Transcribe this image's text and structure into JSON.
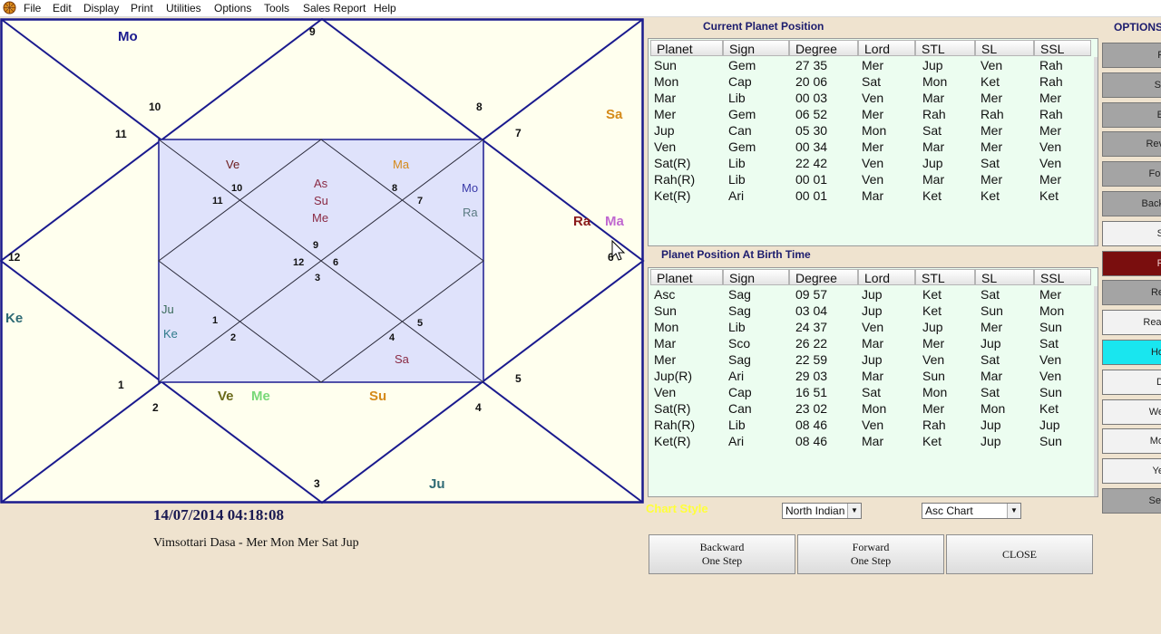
{
  "menu": [
    "File",
    "Edit",
    "Display",
    "Print",
    "Utilities",
    "Options",
    "Tools",
    "Sales Report",
    "Help"
  ],
  "chart": {
    "houses": [
      "1",
      "2",
      "3",
      "4",
      "5",
      "6",
      "7",
      "8",
      "9",
      "10",
      "11",
      "12"
    ],
    "outer_planets": {
      "mo": "Mo",
      "sa": "Sa",
      "ra": "Ra",
      "ma": "Ma",
      "ke": "Ke",
      "ve": "Ve",
      "me": "Me",
      "su": "Su",
      "ju": "Ju"
    },
    "inner_houses": [
      "1",
      "2",
      "3",
      "4",
      "5",
      "6",
      "7",
      "8",
      "9",
      "10",
      "11",
      "12"
    ],
    "inner_planets": {
      "ve": "Ve",
      "as": "As",
      "su": "Su",
      "me": "Me",
      "ma": "Ma",
      "mo": "Mo",
      "ra": "Ra",
      "ju": "Ju",
      "ke": "Ke",
      "sa": "Sa"
    },
    "colors": {
      "line": "#1a1a8e",
      "outer_bg": "#ffffee",
      "inner_bg": "#dfe2fb",
      "inner_line": "#2a2a3a",
      "orange": "#d58a1a",
      "dark_red": "#8a1a1a",
      "violet": "#c068d0",
      "teal": "#2e6a74",
      "olive": "#6a6a1a",
      "light_green": "#78d878",
      "maroon": "#8a2a44"
    }
  },
  "date_time": "14/07/2014 04:18:08",
  "dasa": "Vimsottari Dasa -  Mer Mon Mer Sat Jup",
  "current": {
    "title": "Current Planet Position",
    "headers": [
      "Planet",
      "Sign",
      "Degree",
      "Lord",
      "STL",
      "SL",
      "SSL"
    ],
    "rows": [
      [
        "Sun",
        "Gem",
        "27 35",
        "Mer",
        "Jup",
        "Ven",
        "Rah"
      ],
      [
        "Mon",
        "Cap",
        "20 06",
        "Sat",
        "Mon",
        "Ket",
        "Rah"
      ],
      [
        "Mar",
        "Lib",
        "00 03",
        "Ven",
        "Mar",
        "Mer",
        "Mer"
      ],
      [
        "Mer",
        "Gem",
        "06 52",
        "Mer",
        "Rah",
        "Rah",
        "Rah"
      ],
      [
        "Jup",
        "Can",
        "05 30",
        "Mon",
        "Sat",
        "Mer",
        "Mer"
      ],
      [
        "Ven",
        "Gem",
        "00 34",
        "Mer",
        "Mar",
        "Mer",
        "Ven"
      ],
      [
        "Sat(R)",
        "Lib",
        "22 42",
        "Ven",
        "Jup",
        "Sat",
        "Ven"
      ],
      [
        "Rah(R)",
        "Lib",
        "00 01",
        "Ven",
        "Mar",
        "Mer",
        "Mer"
      ],
      [
        "Ket(R)",
        "Ari",
        "00 01",
        "Mar",
        "Ket",
        "Ket",
        "Ket"
      ]
    ]
  },
  "birth": {
    "title": "Planet Position At Birth Time",
    "headers": [
      "Planet",
      "Sign",
      "Degree",
      "Lord",
      "STL",
      "SL",
      "SSL"
    ],
    "rows": [
      [
        "Asc",
        "Sag",
        "09 57",
        "Jup",
        "Ket",
        "Sat",
        "Mer"
      ],
      [
        "Sun",
        "Sag",
        "03 04",
        "Jup",
        "Ket",
        "Sun",
        "Mon"
      ],
      [
        "Mon",
        "Lib",
        "24 37",
        "Ven",
        "Jup",
        "Mer",
        "Sun"
      ],
      [
        "Mar",
        "Sco",
        "26 22",
        "Mar",
        "Mer",
        "Jup",
        "Sat"
      ],
      [
        "Mer",
        "Sag",
        "22 59",
        "Jup",
        "Ven",
        "Sat",
        "Ven"
      ],
      [
        "Jup(R)",
        "Ari",
        "29 03",
        "Mar",
        "Sun",
        "Mar",
        "Ven"
      ],
      [
        "Ven",
        "Cap",
        "16 51",
        "Sat",
        "Mon",
        "Sat",
        "Sun"
      ],
      [
        "Sat(R)",
        "Can",
        "23 02",
        "Mon",
        "Mer",
        "Mon",
        "Ket"
      ],
      [
        "Rah(R)",
        "Lib",
        "08 46",
        "Ven",
        "Rah",
        "Jup",
        "Jup"
      ],
      [
        "Ket(R)",
        "Ari",
        "08 46",
        "Mar",
        "Ket",
        "Jup",
        "Sun"
      ]
    ]
  },
  "controls": {
    "chart_style_label": "Chart Style",
    "style_select": "North Indian",
    "chart_select": "Asc Chart",
    "backward": [
      "Backward",
      "One Step"
    ],
    "forward": [
      "Forward",
      "One Step"
    ],
    "close": "CLOSE"
  },
  "options": {
    "title": "OPTIONS",
    "buttons": [
      {
        "label": "F",
        "bg": "#a4a4a4"
      },
      {
        "label": "St",
        "bg": "#a4a4a4"
      },
      {
        "label": "E",
        "bg": "#a4a4a4"
      },
      {
        "label": "Rev",
        "bg": "#a4a4a4"
      },
      {
        "label": "For",
        "bg": "#a4a4a4"
      },
      {
        "label": "Back",
        "bg": "#a4a4a4"
      },
      {
        "label": "S",
        "bg": "#f2f2f2"
      },
      {
        "label": "P",
        "bg": "#7a0e0e"
      },
      {
        "label": "Re",
        "bg": "#a4a4a4"
      },
      {
        "label": "Real",
        "bg": "#f2f2f2"
      },
      {
        "label": "Ho",
        "bg": "#19e6ef"
      },
      {
        "label": "D",
        "bg": "#f2f2f2"
      },
      {
        "label": "We",
        "bg": "#f2f2f2"
      },
      {
        "label": "Mo",
        "bg": "#f2f2f2"
      },
      {
        "label": "Ye",
        "bg": "#f2f2f2"
      },
      {
        "label": "Set",
        "bg": "#a4a4a4"
      }
    ]
  }
}
